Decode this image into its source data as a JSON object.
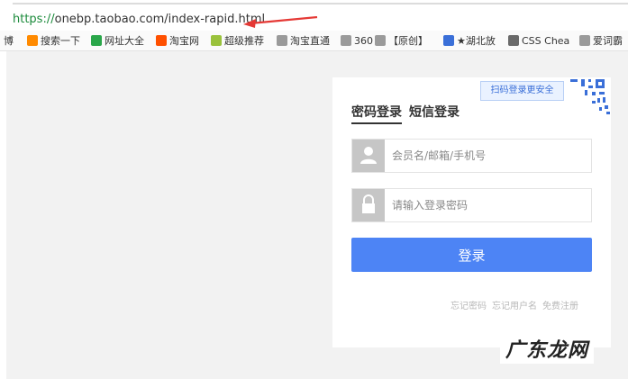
{
  "address_bar": {
    "url_scheme": "https://",
    "url_rest": "onebp.taobao.com/index-rapid.html"
  },
  "bookmarks": [
    {
      "label": "博",
      "icon": "partial-icon",
      "color": "#666666"
    },
    {
      "label": "搜索一下",
      "icon": "search-icon",
      "color": "#ff8a00"
    },
    {
      "label": "网址大全",
      "icon": "globe-icon",
      "color": "#2aa64a"
    },
    {
      "label": "淘宝网",
      "icon": "taobao-icon",
      "color": "#ff5000"
    },
    {
      "label": "超级推荐",
      "icon": "leaf-icon",
      "color": "#9ac23c"
    },
    {
      "label": "淘宝直通",
      "icon": "page-icon",
      "color": "#9a9a9a"
    },
    {
      "label": "360",
      "icon": "folder-icon",
      "color": "#9a9a9a"
    },
    {
      "label": "【原创】",
      "icon": "page-icon",
      "color": "#9a9a9a"
    },
    {
      "label": "★湖北放",
      "icon": "site-icon",
      "color": "#3a6fd8"
    },
    {
      "label": "CSS Chea",
      "icon": "css-icon",
      "color": "#6a6a6a"
    },
    {
      "label": "爱词霸",
      "icon": "page-icon",
      "color": "#9a9a9a"
    }
  ],
  "login": {
    "qr_hint": "扫码登录更安全",
    "tabs": [
      {
        "label": "密码登录",
        "active": true
      },
      {
        "label": "短信登录",
        "active": false
      }
    ],
    "username_placeholder": "会员名/邮箱/手机号",
    "password_placeholder": "请输入登录密码",
    "submit_label": "登录",
    "links": [
      "忘记密码",
      "忘记用户名",
      "免费注册"
    ]
  },
  "watermark": "广东龙网",
  "colors": {
    "accent": "#4d84f5",
    "annotation_arrow": "#e53935"
  }
}
